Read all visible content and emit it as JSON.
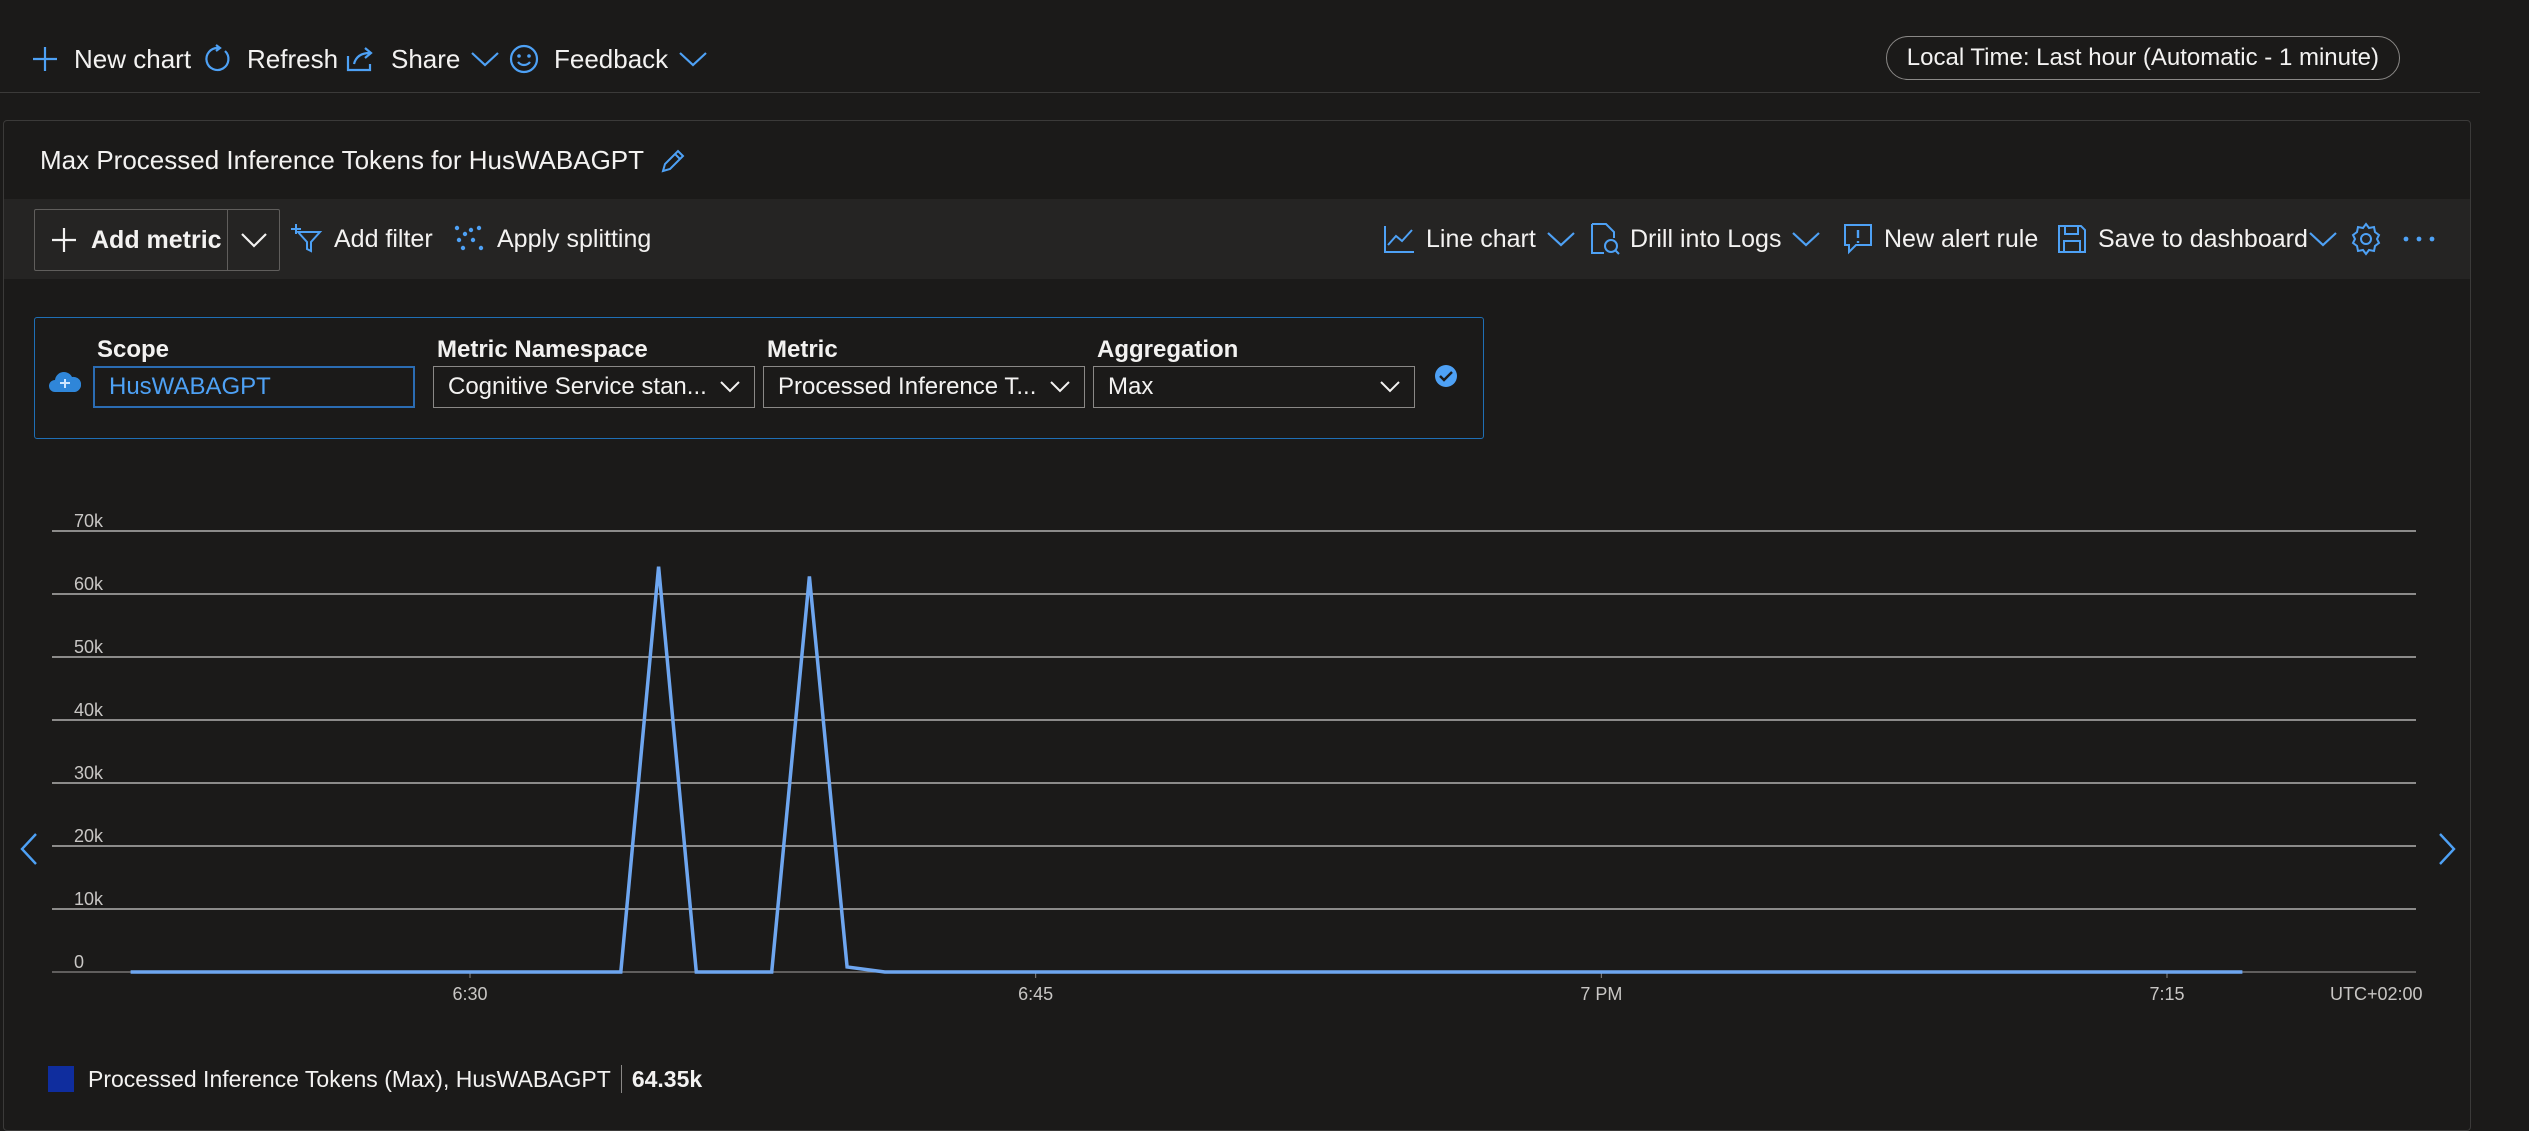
{
  "topbar": {
    "new_chart": "New chart",
    "refresh": "Refresh",
    "share": "Share",
    "feedback": "Feedback",
    "time_range": "Local Time: Last hour (Automatic - 1 minute)"
  },
  "chart": {
    "title": "Max Processed Inference Tokens for HusWABAGPT"
  },
  "toolbar": {
    "add_metric": "Add metric",
    "add_filter": "Add filter",
    "apply_splitting": "Apply splitting",
    "line_chart": "Line chart",
    "drill_into_logs": "Drill into Logs",
    "new_alert_rule": "New alert rule",
    "save_to_dashboard": "Save to dashboard"
  },
  "metric_selector": {
    "scope_label": "Scope",
    "scope_value": "HusWABAGPT",
    "namespace_label": "Metric Namespace",
    "namespace_value": "Cognitive Service stan...",
    "metric_label": "Metric",
    "metric_value": "Processed Inference T...",
    "aggregation_label": "Aggregation",
    "aggregation_value": "Max"
  },
  "colors": {
    "accent": "#4ea1f5",
    "line": "#6ea6f0",
    "legend_swatch": "#0f2d9e",
    "background": "#1b1a19"
  },
  "legend": {
    "label": "Processed Inference Tokens (Max), HusWABAGPT",
    "value": "64.35k"
  },
  "chart_data": {
    "type": "line",
    "ylim": [
      0,
      70000
    ],
    "y_ticks": [
      "0",
      "10k",
      "20k",
      "30k",
      "40k",
      "50k",
      "60k",
      "70k"
    ],
    "x_ticks": [
      "6:30",
      "6:45",
      "7 PM",
      "7:15"
    ],
    "timezone_label": "UTC+02:00",
    "grid": true,
    "series": [
      {
        "name": "Processed Inference Tokens (Max), HusWABAGPT",
        "x": [
          "6:21",
          "6:34",
          "6:35",
          "6:36",
          "6:38",
          "6:39",
          "6:40",
          "6:41",
          "7:17"
        ],
        "values": [
          0,
          0,
          64350,
          0,
          0,
          62800,
          800,
          0,
          0
        ]
      }
    ]
  }
}
